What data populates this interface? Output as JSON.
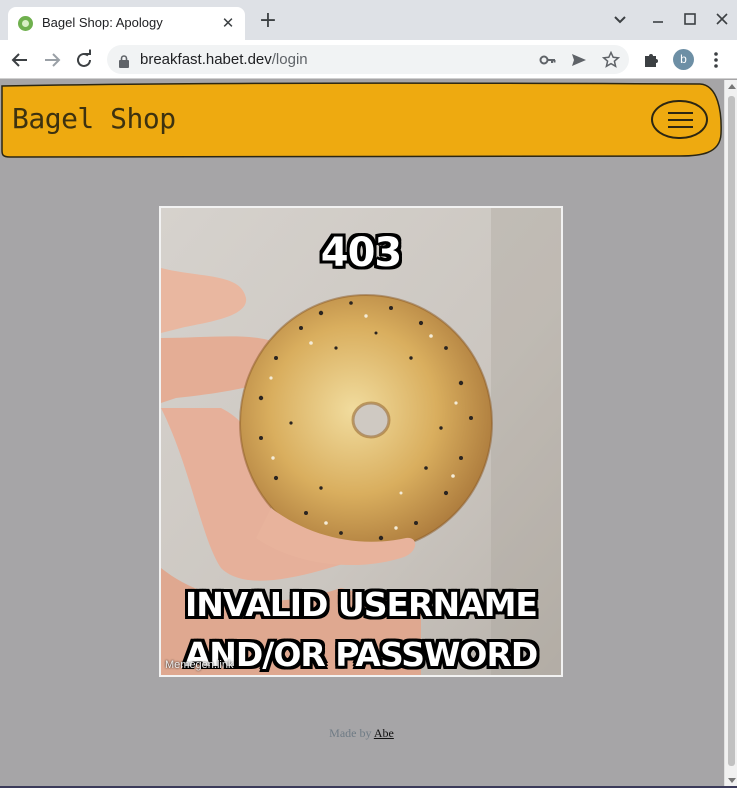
{
  "browser": {
    "tab_title": "Bagel Shop: Apology",
    "tab_close": "✕",
    "new_tab": "+",
    "url_host": "breakfast.habet.dev",
    "url_path": "/login",
    "profile_initial": "b"
  },
  "page": {
    "brand": "Bagel Shop",
    "meme_top": "403",
    "meme_bottom_line1": "INVALID USERNAME",
    "meme_bottom_line2": "AND/OR PASSWORD",
    "watermark": "Memegen.link",
    "footer_prefix": "Made by ",
    "footer_author": "Abe"
  },
  "colors": {
    "navbar": "#eeaa10",
    "page_background": "#a6a5a7"
  }
}
